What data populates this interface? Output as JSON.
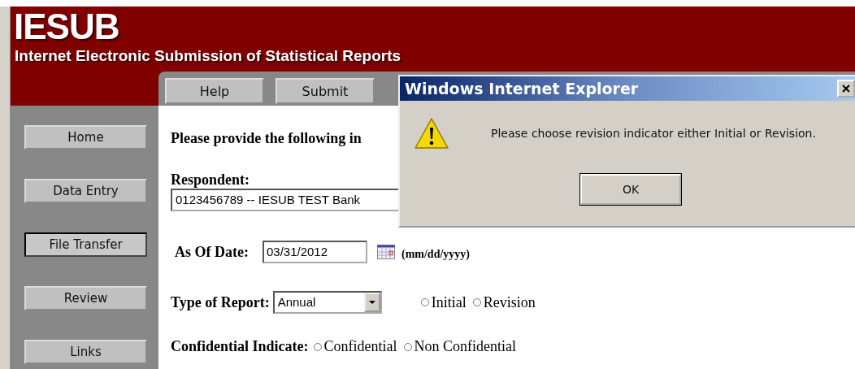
{
  "header": {
    "title": "IESUB",
    "subtitle": "Internet Electronic Submission of Statistical Reports"
  },
  "toolbar": [
    "Help",
    "Submit"
  ],
  "sidebar": {
    "items": [
      {
        "label": "Home",
        "selected": false
      },
      {
        "label": "Data Entry",
        "selected": false
      },
      {
        "label": "File Transfer",
        "selected": true
      },
      {
        "label": "Review",
        "selected": false
      },
      {
        "label": "Links",
        "selected": false
      }
    ]
  },
  "form": {
    "heading": "Please provide the following in",
    "respondent": {
      "label": "Respondent:",
      "value": "0123456789 -- IESUB TEST Bank"
    },
    "as_of_date": {
      "label": "As Of Date:",
      "value": "03/31/2012",
      "hint": "(mm/dd/yyyy)"
    },
    "report_type": {
      "label": "Type of Report:",
      "value": "Annual",
      "options": [
        {
          "label": "Initial",
          "selected": false
        },
        {
          "label": "Revision",
          "selected": false
        }
      ]
    },
    "confidential": {
      "label": "Confidential Indicate:",
      "options": [
        {
          "label": "Confidential",
          "selected": false
        },
        {
          "label": "Non Confidential",
          "selected": false
        }
      ]
    }
  },
  "dialog": {
    "title": "Windows Internet Explorer",
    "message": "Please choose revision indicator either Initial or Revision.",
    "button": "OK"
  }
}
